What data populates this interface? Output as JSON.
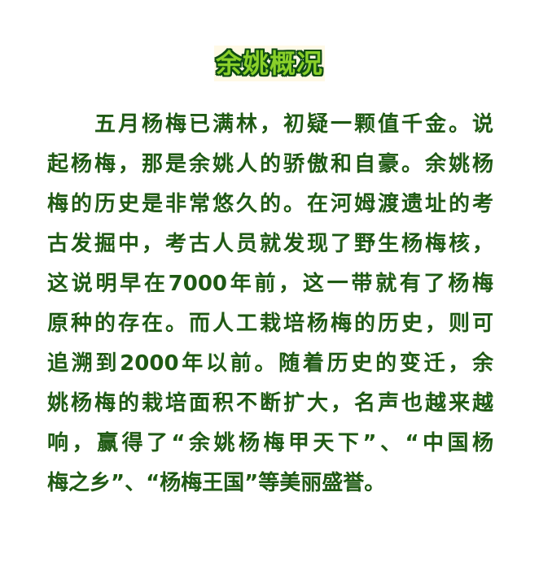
{
  "title": "余姚概况",
  "paragraph_lines": [
    "五月杨梅已满林，初疑一颗值千金。说",
    "起杨梅，那是余姚人的骄傲和自豪。余姚杨",
    "梅的历史是非常悠久的。在河姆渡遗址的考",
    "古发掘中，考古人员就发现了野生杨梅核，",
    "这说明早在7000年前，这一带就有了杨梅",
    "原种的存在。而人工栽培杨梅的历史，则可",
    "追溯到2000年以前。随着历史的变迁，余",
    "姚杨梅的栽培面积不断扩大，名声也越来越",
    "响，赢得了“余姚杨梅甲天下”、“中国杨",
    "梅之乡”、“杨梅王国”等美丽盛誉。"
  ],
  "colors": {
    "title_fill": "#8ad02a",
    "title_outline": "#0e4a12",
    "body_text": "#205a14",
    "background": "#ffffff"
  }
}
